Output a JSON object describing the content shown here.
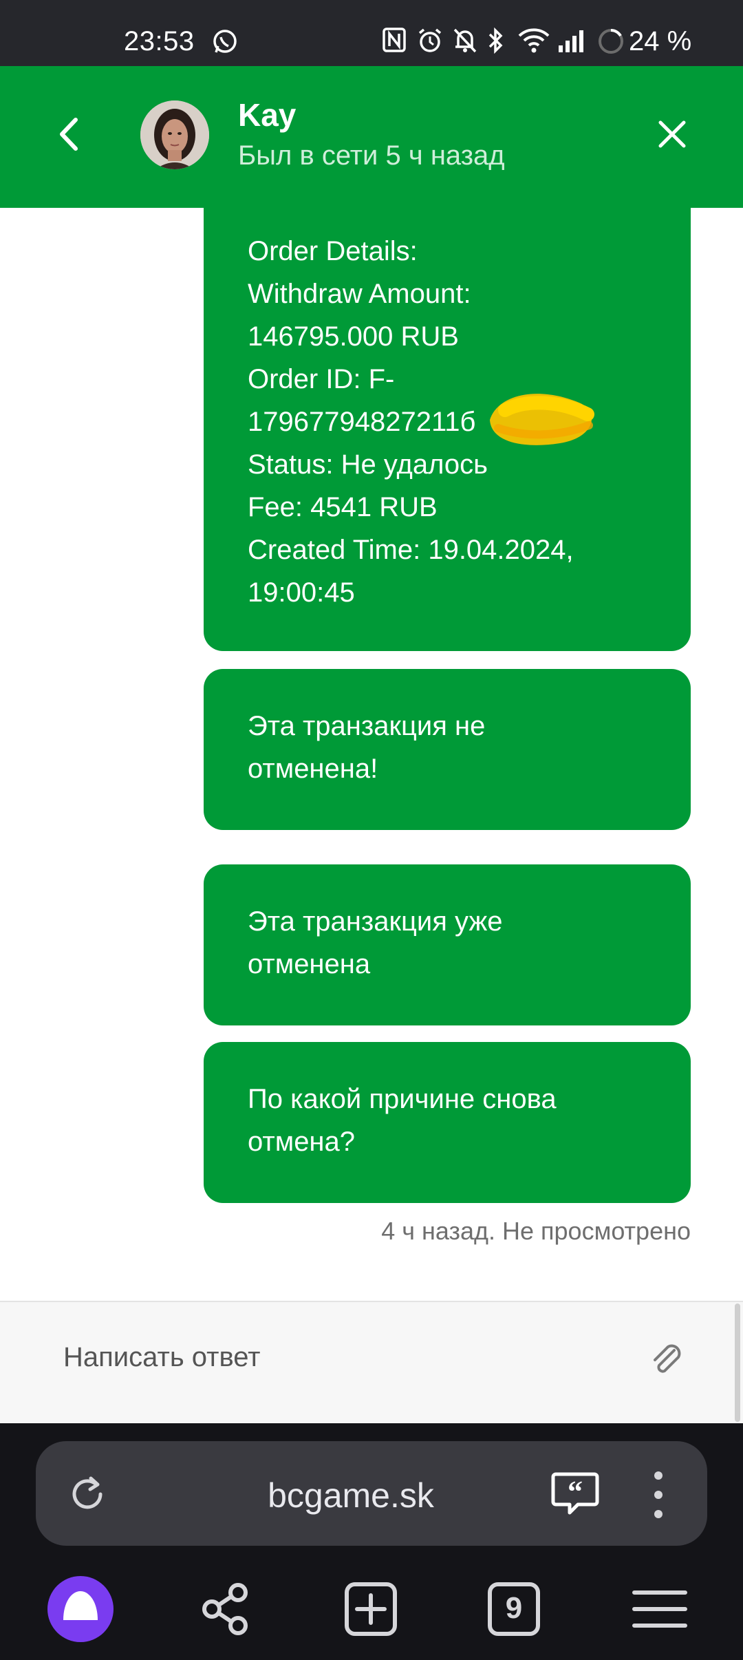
{
  "status_bar": {
    "time": "23:53",
    "battery": "24 %",
    "icons": [
      "whatsapp-icon",
      "nfc-icon",
      "alarm-icon",
      "mute-icon",
      "bluetooth-icon",
      "wifi-icon",
      "signal-icon",
      "battery-icon"
    ]
  },
  "header": {
    "name": "Kay",
    "status": "Был в сети 5 ч назад",
    "color": "#009a37"
  },
  "messages": [
    {
      "lines": [
        "Order Details:",
        "Withdraw Amount:",
        "146795.000 RUB",
        "Order ID: F-",
        "17967794827211б",
        "Status: Не удалось",
        "Fee: 4541 RUB",
        "Created Time: 19.04.2024,",
        "19:00:45"
      ]
    },
    {
      "lines": [
        "Эта транзакция не",
        "отменена!"
      ]
    },
    {
      "lines": [
        "Эта транзакция уже",
        "отменена"
      ]
    },
    {
      "lines": [
        "По какой причине снова",
        "отмена?"
      ]
    }
  ],
  "message_meta": "4 ч назад. Не просмотрено",
  "reply": {
    "placeholder": "Написать ответ"
  },
  "browser": {
    "url": "bcgame.sk",
    "tab_count": "9"
  }
}
